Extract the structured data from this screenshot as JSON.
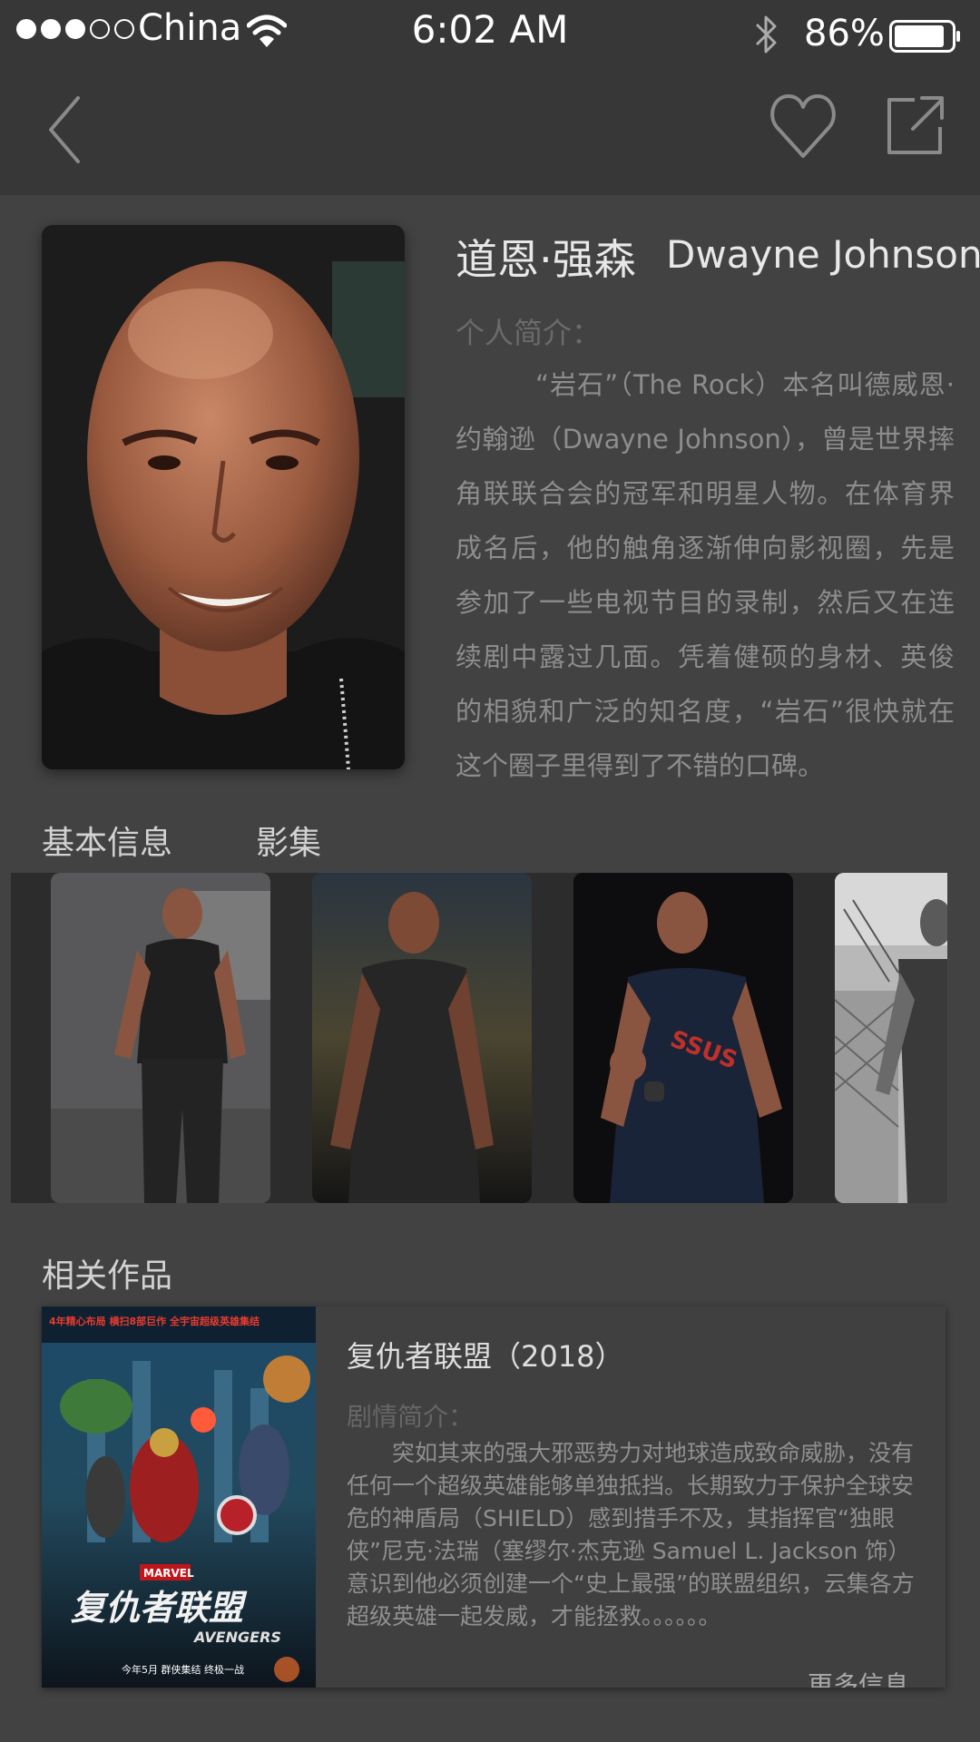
{
  "status_bar": {
    "carrier": "China",
    "time": "6:02 AM",
    "battery": "86%",
    "signal_dots_filled": 3,
    "signal_dots_total": 5,
    "battery_level": 0.86,
    "icons": [
      "wifi-icon",
      "bluetooth-icon",
      "battery-icon"
    ]
  },
  "nav": {
    "icons": [
      "back-chevron-icon",
      "heart-icon",
      "share-icon"
    ]
  },
  "profile": {
    "name_cn": "道恩·强森",
    "name_en": "Dwayne Johnson",
    "bio_label": "个人简介：",
    "bio": "“岩石”（The Rock）本名叫德威恩·约翰逊（Dwayne Johnson），曾是世界摔角联联合会的冠军和明星人物。在体育界成名后，他的触角逐渐伸向影视圈，先是参加了一些电视节目的录制，然后又在连续剧中露过几面。凭着健硕的身材、英俊的相貌和广泛的知名度，“岩石”很快就在这个圈子里得到了不错的口碑。"
  },
  "tabs": [
    {
      "label": "基本信息"
    },
    {
      "label": "影集"
    }
  ],
  "related": {
    "title": "相关作品",
    "items": [
      {
        "title": "复仇者联盟（2018）",
        "plot_label": "剧情简介：",
        "plot": "突如其来的强大邪恶势力对地球造成致命威胁，没有任何一个超级英雄能够单独抵挡。长期致力于保护全球安危的神盾局（SHIELD）感到措手不及，其指挥官“独眼侠”尼克·法瑞（塞缪尔·杰克逊 Samuel L. Jackson 饰）意识到他必须创建一个“史上最强”的联盟组织，云集各方超级英雄一起发威，才能拯救。。。。。。",
        "more": "更多信息",
        "poster_text": {
          "banner": "4年精心布局 横扫8部巨作 全宇宙超级英雄集结",
          "studio": "MARVEL",
          "title_cn": "复仇者联盟",
          "title_en": "AVENGERS",
          "release": "今年5月 群侠集结 终极一战"
        }
      }
    ]
  },
  "colors": {
    "background": "#424242",
    "bars": "#373737",
    "gallery_strip": "#2c2c2c"
  }
}
